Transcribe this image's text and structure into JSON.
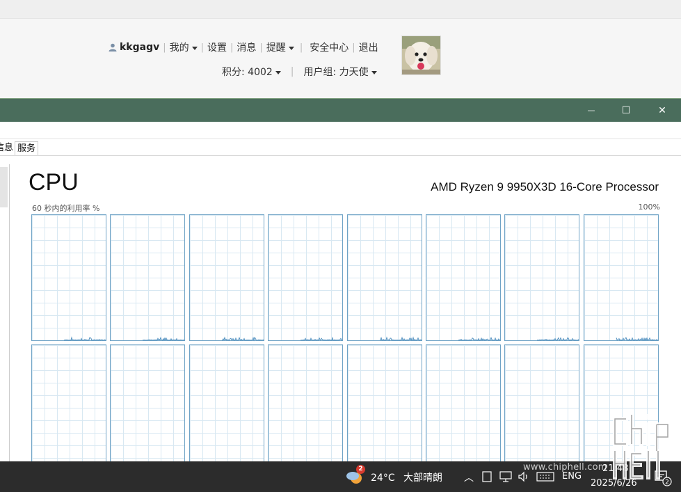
{
  "forum": {
    "username": "kkgagv",
    "menu": [
      {
        "label": "我的",
        "dropdown": true
      },
      {
        "label": "设置",
        "dropdown": false
      },
      {
        "label": "消息",
        "dropdown": false
      },
      {
        "label": "提醒",
        "dropdown": true
      },
      {
        "label": "安全中心",
        "dropdown": false
      },
      {
        "label": "退出",
        "dropdown": false
      }
    ],
    "points": "积分: 4002",
    "usergroup": "用户组: 力天使"
  },
  "taskmanager": {
    "window_buttons": {
      "minimize": "—",
      "maximize": "☐",
      "close": "✕"
    },
    "tabs": [
      "信息",
      "服务"
    ],
    "title": "CPU",
    "processor": "AMD Ryzen 9 9950X3D 16-Core Processor",
    "utilization_label": "60 秒内的利用率 %",
    "utilization_max": "100%",
    "core_count": 16,
    "colors": {
      "graph_line": "#4f8fbf",
      "graph_border": "#6fa3c6",
      "titlebar": "#4a6d5c"
    }
  },
  "taskbar": {
    "weather_badge": "2",
    "temperature": "24°C",
    "weather": "大部晴朗",
    "language": "ENG",
    "time": "21:48",
    "date": "2025/6/26",
    "notification_count": "2"
  },
  "watermark": {
    "url": "www.chiphell.com"
  }
}
